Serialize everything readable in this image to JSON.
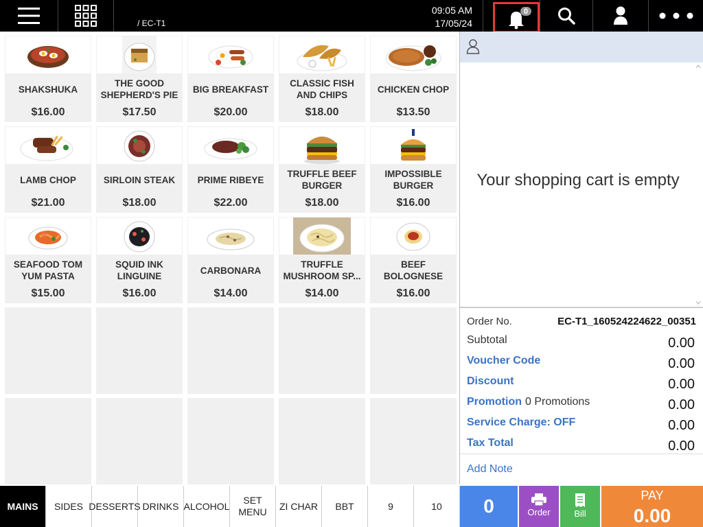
{
  "topbar": {
    "table": "/ EC-T1",
    "time": "09:05 AM",
    "date": "17/05/24",
    "notification_count": "0"
  },
  "icons": {
    "menu": "hamburger-icon",
    "grid": "grid-icon",
    "notifications": "bell-icon",
    "search": "search-icon",
    "user": "user-icon",
    "more": "more-dots-icon"
  },
  "products": [
    {
      "name": "SHAKSHUKA",
      "price": "$16.00",
      "dish": "pan"
    },
    {
      "name": "THE GOOD SHEPHERD'S PIE",
      "price": "$17.50",
      "dish": "pie"
    },
    {
      "name": "BIG BREAKFAST",
      "price": "$20.00",
      "dish": "breakfast"
    },
    {
      "name": "CLASSIC FISH AND CHIPS",
      "price": "$18.00",
      "dish": "fish"
    },
    {
      "name": "CHICKEN CHOP",
      "price": "$13.50",
      "dish": "chop"
    },
    {
      "name": "LAMB CHOP",
      "price": "$21.00",
      "dish": "lamb"
    },
    {
      "name": "SIRLOIN STEAK",
      "price": "$18.00",
      "dish": "sirloin"
    },
    {
      "name": "PRIME RIBEYE",
      "price": "$22.00",
      "dish": "ribeye"
    },
    {
      "name": "TRUFFLE BEEF BURGER",
      "price": "$18.00",
      "dish": "burger"
    },
    {
      "name": "IMPOSSIBLE BURGER",
      "price": "$16.00",
      "dish": "burger2"
    },
    {
      "name": "SEAFOOD TOM YUM PASTA",
      "price": "$15.00",
      "dish": "tomyum"
    },
    {
      "name": "SQUID INK LINGUINE",
      "price": "$16.00",
      "dish": "squid"
    },
    {
      "name": "CARBONARA",
      "price": "$14.00",
      "dish": "carbonara"
    },
    {
      "name": "TRUFFLE MUSHROOM SP...",
      "price": "$14.00",
      "dish": "truffle"
    },
    {
      "name": "BEEF BOLOGNESE",
      "price": "$16.00",
      "dish": "bolognese"
    }
  ],
  "categories": [
    {
      "label": "MAINS",
      "active": true
    },
    {
      "label": "SIDES"
    },
    {
      "label": "DESSERTS"
    },
    {
      "label": "DRINKS"
    },
    {
      "label": "ALCOHOL"
    },
    {
      "label": "SET MENU"
    },
    {
      "label": "ZI CHAR"
    },
    {
      "label": "BBT"
    },
    {
      "label": "9"
    },
    {
      "label": "10"
    }
  ],
  "cart": {
    "empty_message": "Your shopping cart is empty",
    "order_label": "Order No.",
    "order_no": "EC-T1_160524224622_00351",
    "subtotal_label": "Subtotal",
    "subtotal": "0.00",
    "voucher_label": "Voucher Code",
    "voucher": "0.00",
    "discount_label": "Discount",
    "discount": "0.00",
    "promotion_label": "Promotion",
    "promotion_count": "0 Promotions",
    "promotion": "0.00",
    "service_label": "Service Charge: OFF",
    "service": "0.00",
    "tax_label": "Tax Total",
    "tax": "0.00",
    "add_note": "Add Note"
  },
  "actions": {
    "count": "0",
    "order_label": "Order",
    "bill_label": "Bill",
    "pay_label": "PAY",
    "pay_amount": "0.00"
  },
  "colors": {
    "topbar": "#000000",
    "count_button": "#4a86e8",
    "order_button": "#9c4fc5",
    "bill_button": "#4fb858",
    "pay_button": "#f0883a",
    "link": "#3a73c6",
    "highlight": "#e53935"
  }
}
